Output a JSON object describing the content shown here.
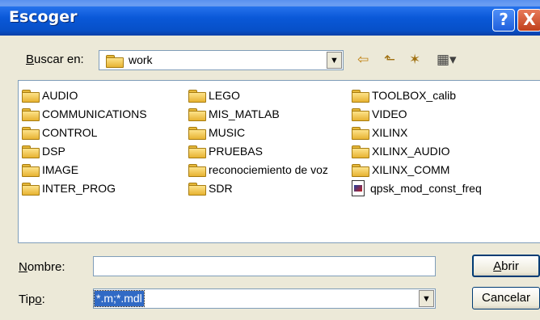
{
  "window": {
    "title": "Escoger",
    "help_label": "?",
    "close_label": "X"
  },
  "lookin": {
    "label_prefix": "B",
    "label_rest": "uscar en:",
    "value": "work",
    "arrow": "▼"
  },
  "toolbar": {
    "back_icon": "⇦",
    "up_icon": "⬑",
    "new_folder_icon": "✶",
    "view_menu_icon": "▦▾"
  },
  "files": [
    {
      "name": "AUDIO",
      "type": "folder"
    },
    {
      "name": "COMMUNICATIONS",
      "type": "folder"
    },
    {
      "name": "CONTROL",
      "type": "folder"
    },
    {
      "name": "DSP",
      "type": "folder"
    },
    {
      "name": "IMAGE",
      "type": "folder"
    },
    {
      "name": "INTER_PROG",
      "type": "folder"
    },
    {
      "name": "LEGO",
      "type": "folder"
    },
    {
      "name": "MIS_MATLAB",
      "type": "folder"
    },
    {
      "name": "MUSIC",
      "type": "folder"
    },
    {
      "name": "PRUEBAS",
      "type": "folder"
    },
    {
      "name": "reconociemiento de voz",
      "type": "folder"
    },
    {
      "name": "SDR",
      "type": "folder"
    },
    {
      "name": "TOOLBOX_calib",
      "type": "folder"
    },
    {
      "name": "VIDEO",
      "type": "folder"
    },
    {
      "name": "XILINX",
      "type": "folder"
    },
    {
      "name": "XILINX_AUDIO",
      "type": "folder"
    },
    {
      "name": "XILINX_COMM",
      "type": "folder"
    },
    {
      "name": "qpsk_mod_const_freq",
      "type": "model-file"
    }
  ],
  "filename": {
    "label_prefix": "N",
    "label_rest": "ombre:",
    "value": ""
  },
  "filetype": {
    "label_prefix": "Tip",
    "label_key": "o",
    "label_rest": ":",
    "value": "*.m;*.mdl",
    "arrow": "▼"
  },
  "buttons": {
    "open_prefix": "A",
    "open_rest": "brir",
    "cancel": "Cancelar"
  }
}
